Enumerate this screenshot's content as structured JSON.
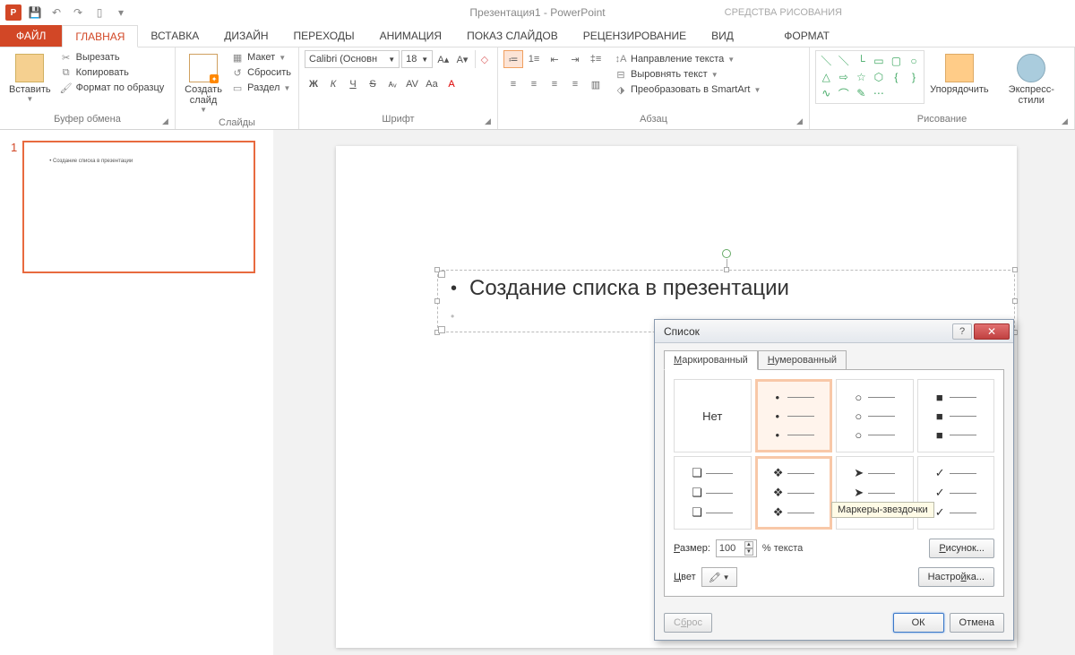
{
  "app": {
    "title": "Презентация1 - PowerPoint",
    "context_tab_title": "СРЕДСТВА РИСОВАНИЯ"
  },
  "tabs": {
    "file": "ФАЙЛ",
    "home": "ГЛАВНАЯ",
    "insert": "ВСТАВКА",
    "design": "ДИЗАЙН",
    "transitions": "ПЕРЕХОДЫ",
    "animation": "АНИМАЦИЯ",
    "slideshow": "ПОКАЗ СЛАЙДОВ",
    "review": "РЕЦЕНЗИРОВАНИЕ",
    "view": "ВИД",
    "format": "ФОРМАТ"
  },
  "ribbon": {
    "clipboard": {
      "label": "Буфер обмена",
      "paste": "Вставить",
      "cut": "Вырезать",
      "copy": "Копировать",
      "fmt_painter": "Формат по образцу"
    },
    "slides": {
      "label": "Слайды",
      "new_slide": "Создать слайд",
      "layout": "Макет",
      "reset": "Сбросить",
      "section": "Раздел"
    },
    "font": {
      "label": "Шрифт",
      "name": "Calibri (Основн",
      "size": "18"
    },
    "paragraph": {
      "label": "Абзац",
      "text_direction": "Направление текста",
      "align_text": "Выровнять текст",
      "smartart": "Преобразовать в SmartArt"
    },
    "drawing": {
      "label": "Рисование",
      "arrange": "Упорядочить",
      "quick_styles": "Экспресс-стили"
    }
  },
  "slide_panel": {
    "num": "1",
    "thumb_text": "Создание списка в презентации"
  },
  "slide": {
    "bullet_text": "Создание списка в презентации"
  },
  "dialog": {
    "title": "Список",
    "tabs": {
      "bulleted": "Маркированный",
      "numbered": "Нумерованный"
    },
    "none": "Нет",
    "tooltip": "Маркеры-звездочки",
    "size_label": "Размер:",
    "size_value": "100",
    "size_suffix": "% текста",
    "color_label": "Цвет",
    "picture_btn": "Рисунок...",
    "customize_btn": "Настройка...",
    "reset_btn": "Сброс",
    "ok_btn": "ОК",
    "cancel_btn": "Отмена"
  }
}
